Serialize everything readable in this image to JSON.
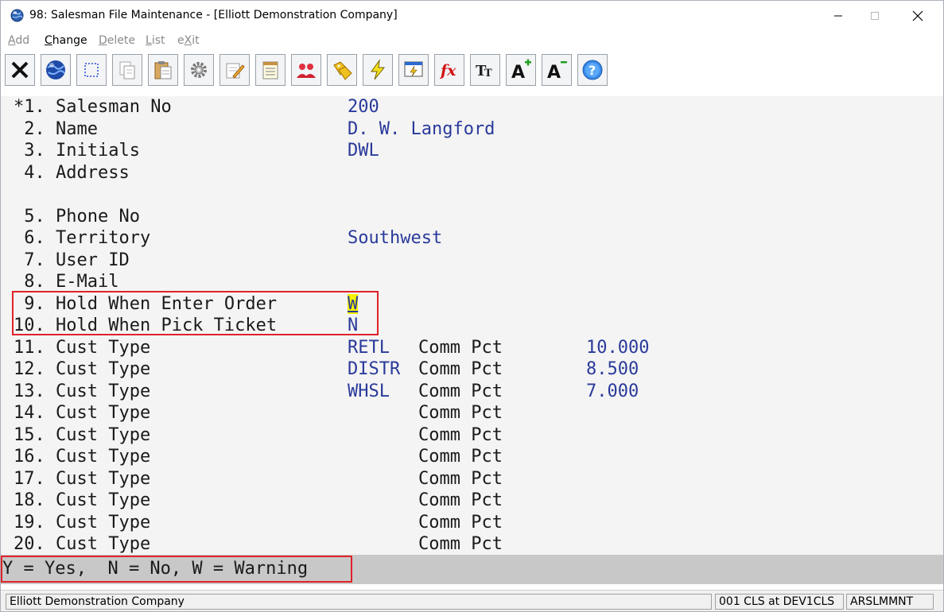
{
  "window": {
    "title": "98: Salesman File Maintenance - [Elliott Demonstration Company]",
    "icon": "globe-icon"
  },
  "menu": {
    "items": [
      {
        "label": "Add",
        "hotkey": "A",
        "rest": "dd",
        "enabled": false
      },
      {
        "label": "Change",
        "hotkey": "C",
        "rest": "hange",
        "enabled": true
      },
      {
        "label": "Delete",
        "hotkey": "D",
        "rest": "elete",
        "enabled": false
      },
      {
        "label": "List",
        "hotkey": "L",
        "rest": "ist",
        "enabled": false
      },
      {
        "label": "eXit",
        "pre": "e",
        "hotkey": "X",
        "rest": "it",
        "enabled": false
      }
    ]
  },
  "toolbar": {
    "buttons": [
      "close-icon",
      "globe-icon",
      "select-icon",
      "copy-icon",
      "paste-icon",
      "settings-icon",
      "edit-note-icon",
      "notepad-icon",
      "users-icon",
      "tags-icon",
      "lightning-icon",
      "screen-lightning-icon",
      "function-icon",
      "font-size-icon",
      "font-increase-icon",
      "font-decrease-icon",
      "help-icon"
    ]
  },
  "fields": [
    {
      "num": "*1.",
      "label": "Salesman No",
      "value": "200"
    },
    {
      "num": " 2.",
      "label": "Name",
      "value": "D. W. Langford"
    },
    {
      "num": " 3.",
      "label": "Initials",
      "value": "DWL"
    },
    {
      "num": " 4.",
      "label": "Address",
      "value": ""
    },
    {
      "num": " 5.",
      "label": "Phone No",
      "value": ""
    },
    {
      "num": " 6.",
      "label": "Territory",
      "value": "Southwest"
    },
    {
      "num": " 7.",
      "label": "User ID",
      "value": ""
    },
    {
      "num": " 8.",
      "label": "E-Mail",
      "value": ""
    },
    {
      "num": " 9.",
      "label": "Hold When Enter Order",
      "value": "W"
    },
    {
      "num": "10.",
      "label": "Hold When Pick Ticket",
      "value": "N"
    }
  ],
  "cust_types": {
    "comm_label": "Comm Pct",
    "rows": [
      {
        "num": "11.",
        "label": "Cust Type",
        "type": "RETL",
        "pct": "10.000"
      },
      {
        "num": "12.",
        "label": "Cust Type",
        "type": "DISTR",
        "pct": "8.500"
      },
      {
        "num": "13.",
        "label": "Cust Type",
        "type": "WHSL",
        "pct": "7.000"
      },
      {
        "num": "14.",
        "label": "Cust Type",
        "type": "",
        "pct": ""
      },
      {
        "num": "15.",
        "label": "Cust Type",
        "type": "",
        "pct": ""
      },
      {
        "num": "16.",
        "label": "Cust Type",
        "type": "",
        "pct": ""
      },
      {
        "num": "17.",
        "label": "Cust Type",
        "type": "",
        "pct": ""
      },
      {
        "num": "18.",
        "label": "Cust Type",
        "type": "",
        "pct": ""
      },
      {
        "num": "19.",
        "label": "Cust Type",
        "type": "",
        "pct": ""
      },
      {
        "num": "20.",
        "label": "Cust Type",
        "type": "",
        "pct": ""
      }
    ]
  },
  "message": "Y = Yes,  N = No, W = Warning",
  "status": {
    "company": "Elliott Demonstration Company",
    "user": "001 CLS at DEV1CLS",
    "program": "ARSLMMNT"
  },
  "colors": {
    "value_text": "#2a3a9a",
    "highlight_box": "#e0222a",
    "cursor_bg": "#f5f200"
  }
}
